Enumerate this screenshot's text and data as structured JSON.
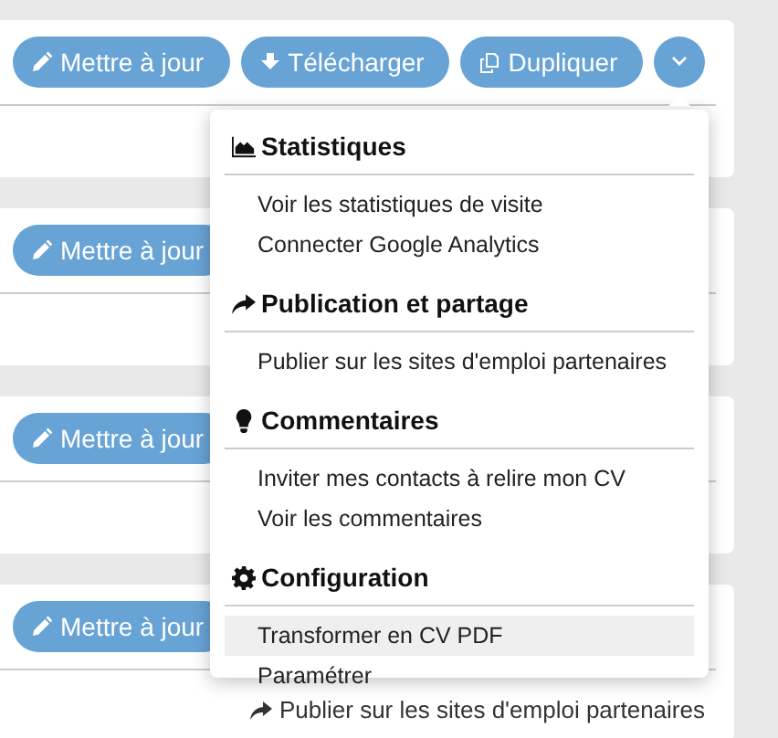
{
  "cards": [
    {
      "buttons": [
        {
          "kind": "update",
          "label": "Mettre à jour"
        },
        {
          "kind": "download",
          "label": "Télécharger"
        },
        {
          "kind": "duplicate",
          "label": "Dupliquer"
        },
        {
          "kind": "more",
          "expanded": true
        }
      ]
    },
    {
      "buttons": [
        {
          "kind": "update",
          "label": "Mettre à jour"
        }
      ]
    },
    {
      "buttons": [
        {
          "kind": "update",
          "label": "Mettre à jour"
        }
      ]
    },
    {
      "buttons": [
        {
          "kind": "update",
          "label": "Mettre à jour"
        }
      ],
      "footer_link": {
        "label": "Publier sur les sites d'emploi partenaires"
      }
    }
  ],
  "menu": {
    "sections": [
      {
        "title": "Statistiques",
        "items": [
          {
            "label": "Voir les statistiques de visite",
            "highlighted": false
          },
          {
            "label": "Connecter Google Analytics",
            "highlighted": false
          }
        ]
      },
      {
        "title": "Publication et partage",
        "items": [
          {
            "label": "Publier sur les sites d'emploi partenaires",
            "highlighted": false
          }
        ]
      },
      {
        "title": "Commentaires",
        "items": [
          {
            "label": "Inviter mes contacts à relire mon CV",
            "highlighted": false
          },
          {
            "label": "Voir les commentaires",
            "highlighted": false
          }
        ]
      },
      {
        "title": "Configuration",
        "items": [
          {
            "label": "Transformer en CV PDF",
            "highlighted": true
          },
          {
            "label": "Paramétrer",
            "highlighted": false
          }
        ]
      }
    ]
  }
}
